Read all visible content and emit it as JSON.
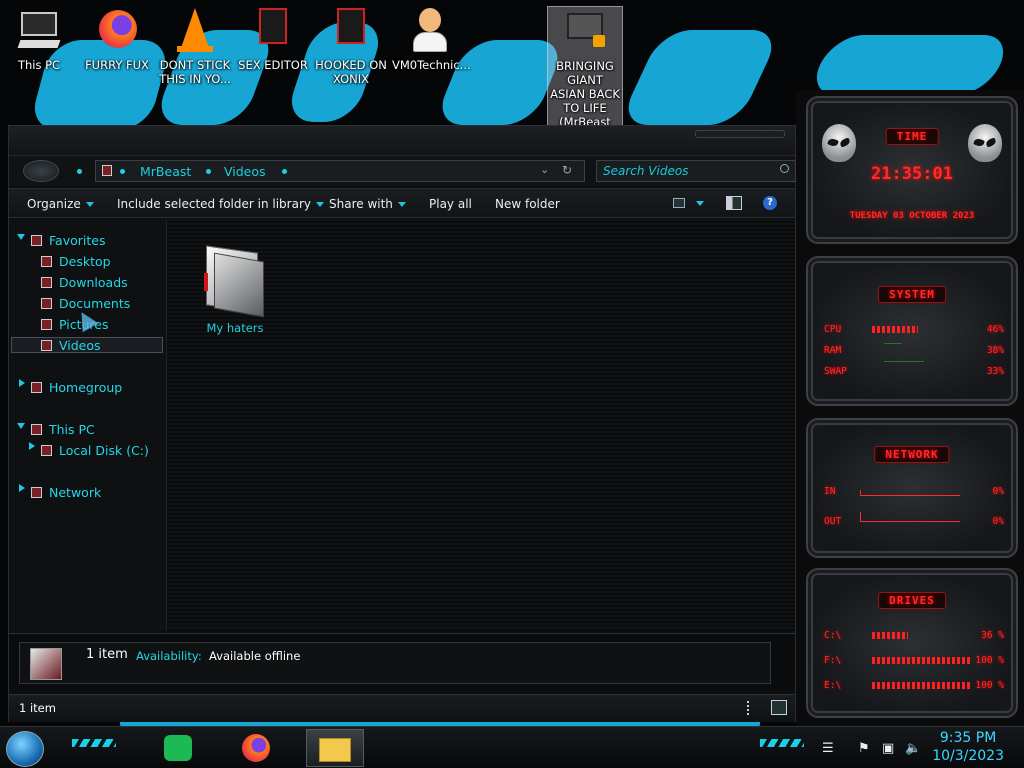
{
  "desktop": {
    "icons": [
      {
        "label": "This PC",
        "icon": "this-pc-icon"
      },
      {
        "label": "FURRY FUX",
        "icon": "firefox-icon"
      },
      {
        "label": "DONT STICK THIS IN YO...",
        "icon": "vlc-icon"
      },
      {
        "label": "SEX EDITOR",
        "icon": "app-icon"
      },
      {
        "label": "HOOKED ON XONIX",
        "icon": "app-icon"
      },
      {
        "label": "VM0Technic...",
        "icon": "user-icon"
      },
      {
        "label": "BRINGING GIANT ASIAN BACK TO LIFE (MrBeast Deleted...",
        "icon": "video-file-icon"
      }
    ]
  },
  "explorer": {
    "breadcrumb": [
      "MrBeast",
      "Videos"
    ],
    "search_placeholder": "Search Videos",
    "toolbar": {
      "organize": "Organize",
      "include": "Include selected folder in library",
      "share": "Share with",
      "play_all": "Play all",
      "new_folder": "New folder"
    },
    "sidebar": {
      "favorites": "Favorites",
      "desktop": "Desktop",
      "downloads": "Downloads",
      "documents": "Documents",
      "pictures": "Pictures",
      "videos": "Videos",
      "homegroup": "Homegroup",
      "this_pc": "This PC",
      "local_disk": "Local Disk (C:)",
      "network": "Network"
    },
    "items": [
      {
        "name": "My haters"
      }
    ],
    "details": {
      "count": "1 item",
      "availability_label": "Availability:",
      "availability_value": "Available offline"
    },
    "status": "1 item"
  },
  "gadgets": {
    "time": {
      "title": "TIME",
      "clock": "21:35:01",
      "date": "TUESDAY 03 OCTOBER 2023"
    },
    "system": {
      "title": "SYSTEM",
      "rows": [
        {
          "label": "CPU",
          "value": "46%",
          "level": 0.46
        },
        {
          "label": "RAM",
          "value": "38%",
          "level": 0.0
        },
        {
          "label": "SWAP",
          "value": "33%",
          "level": 0.0
        }
      ]
    },
    "network": {
      "title": "NETWORK",
      "rows": [
        {
          "label": "IN",
          "value": "0%"
        },
        {
          "label": "OUT",
          "value": "0%"
        }
      ]
    },
    "drives": {
      "title": "DRIVES",
      "rows": [
        {
          "label": "C:\\",
          "value": "36 %",
          "level": 0.36
        },
        {
          "label": "F:\\",
          "value": "100 %",
          "level": 1.0
        },
        {
          "label": "E:\\",
          "value": "100 %",
          "level": 1.0
        }
      ]
    }
  },
  "taskbar": {
    "time": "9:35 PM",
    "date": "10/3/2023",
    "apps": [
      "spotify-icon",
      "firefox-icon",
      "file-explorer-icon"
    ]
  },
  "colors": {
    "accent": "#22d8e6",
    "gadget_red": "#ff2a2a",
    "wallpaper_blue": "#17a5d4"
  }
}
